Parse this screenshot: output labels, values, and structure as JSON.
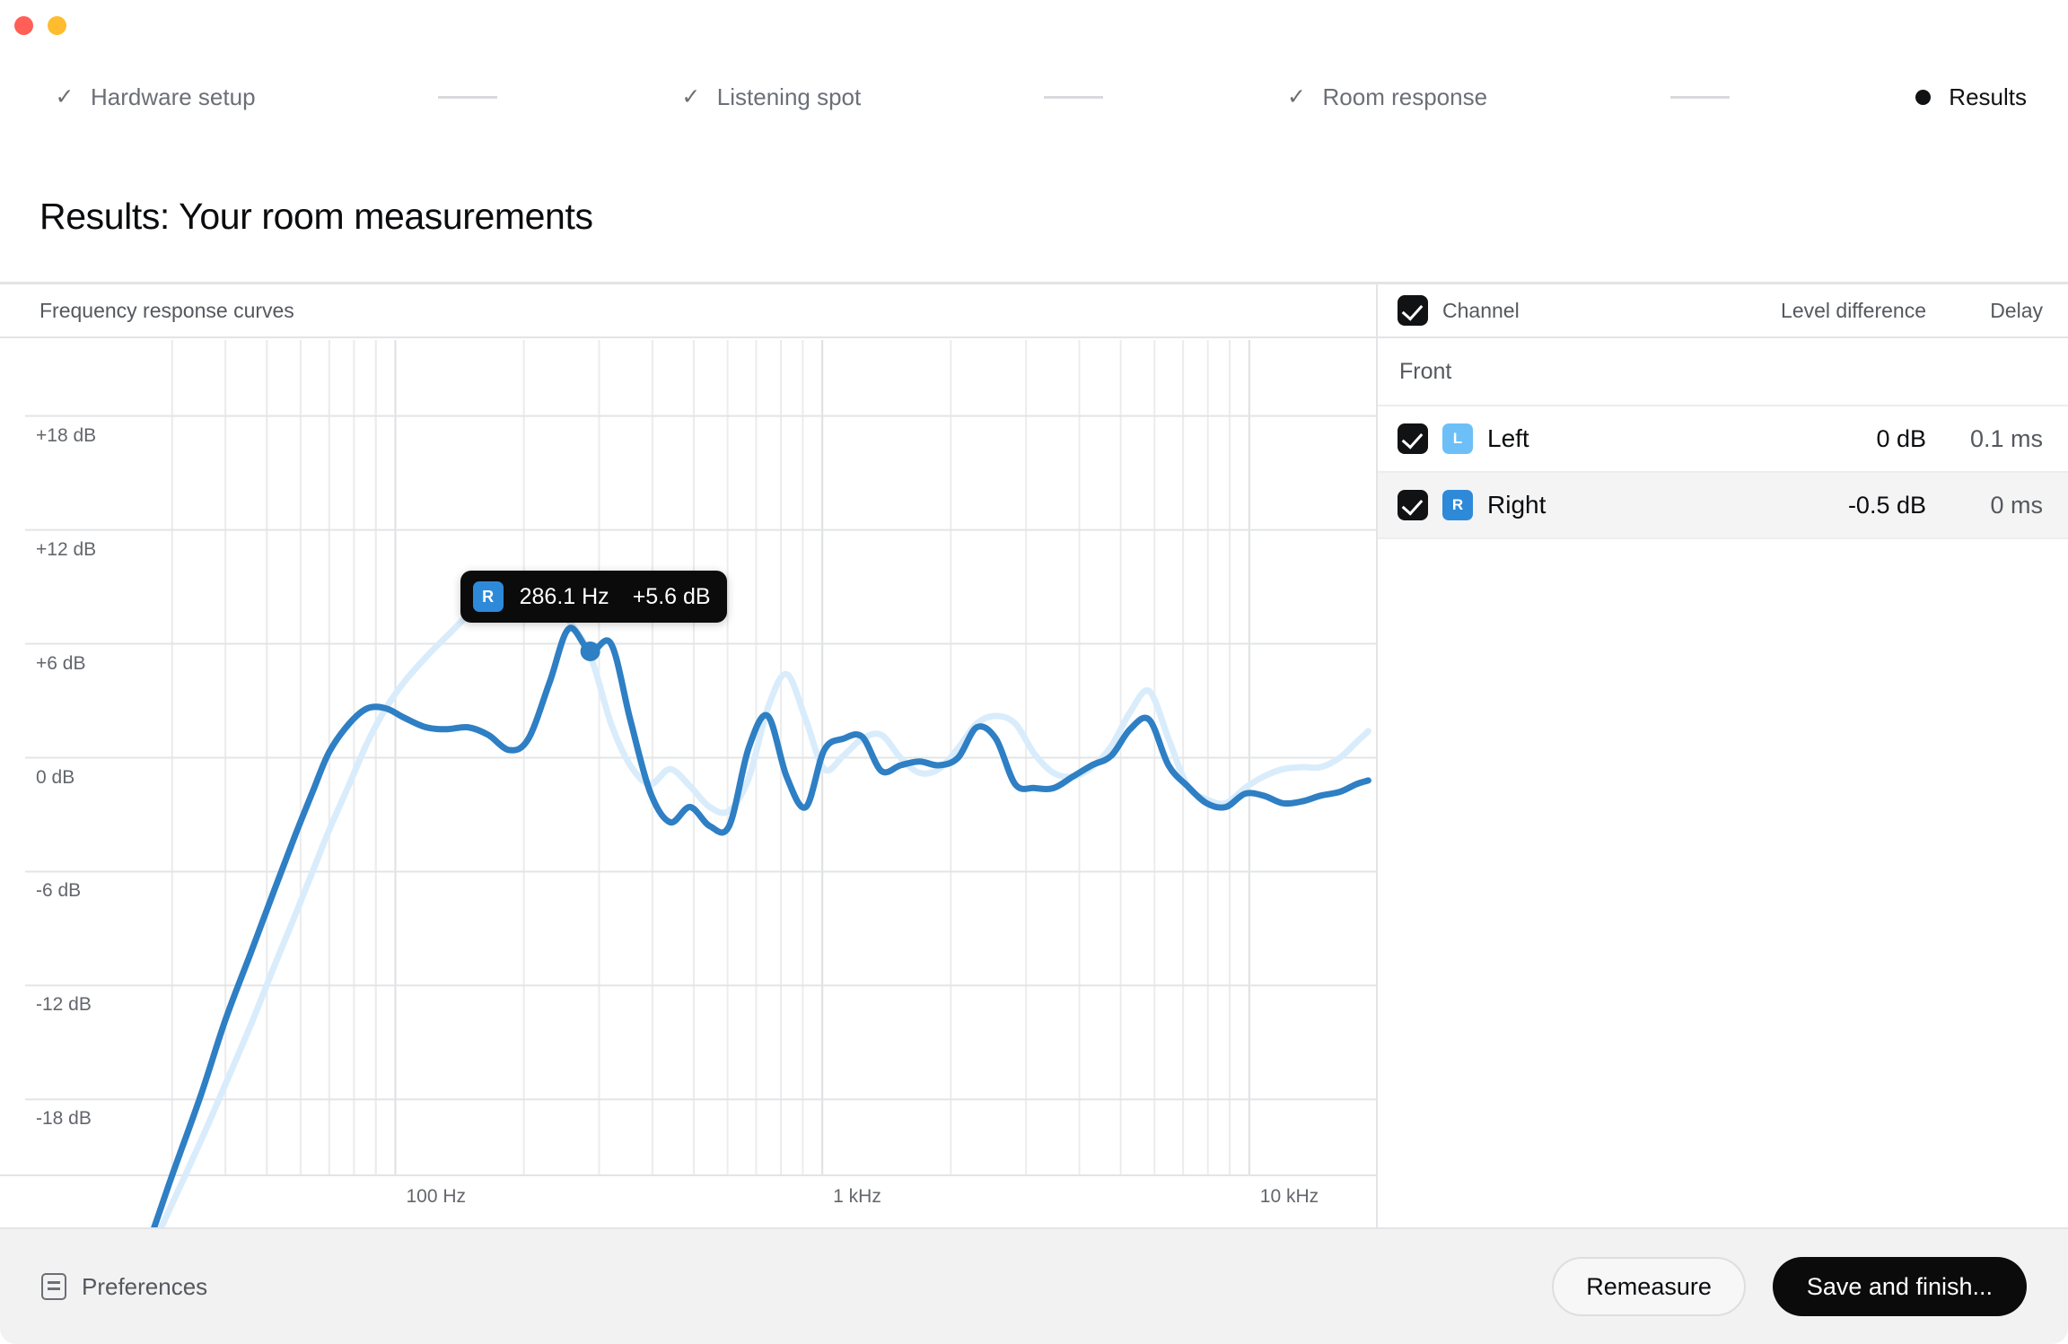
{
  "window": {
    "traffic_lights": [
      "close",
      "minimize"
    ]
  },
  "stepper": {
    "steps": [
      {
        "label": "Hardware setup",
        "mark": "check",
        "state": "done"
      },
      {
        "label": "Listening spot",
        "mark": "check",
        "state": "done"
      },
      {
        "label": "Room response",
        "mark": "check",
        "state": "done"
      },
      {
        "label": "Results",
        "mark": "bullet",
        "state": "current"
      }
    ]
  },
  "page": {
    "title": "Results: Your room measurements"
  },
  "chart_panel": {
    "header": "Frequency response curves"
  },
  "tooltip": {
    "badge": "R",
    "frequency": "286.1 Hz",
    "level": "+5.6 dB"
  },
  "table": {
    "header": {
      "select_all_checked": true,
      "channel": "Channel",
      "level_difference": "Level difference",
      "delay": "Delay"
    },
    "groups": [
      {
        "name": "Front",
        "rows": [
          {
            "checked": true,
            "badge": "L",
            "badge_color": "#6cc0f7",
            "name": "Left",
            "level": "0 dB",
            "delay": "0.1 ms",
            "selected": false
          },
          {
            "checked": true,
            "badge": "R",
            "badge_color": "#2e8ad9",
            "name": "Right",
            "level": "-0.5 dB",
            "delay": "0 ms",
            "selected": true
          }
        ]
      }
    ]
  },
  "footer": {
    "preferences": "Preferences",
    "remeasure": "Remeasure",
    "save_and_finish": "Save and finish..."
  },
  "colors": {
    "accent_right": "#2e7fc4",
    "accent_left": "#d9ecfb",
    "black": "#0b0b0c",
    "grid": "#e3e4e6",
    "text_muted": "#63666c"
  },
  "chart_data": {
    "type": "line",
    "title": "Frequency response curves",
    "xlabel": "Frequency",
    "ylabel": "Level",
    "xscale": "log",
    "xlim": [
      20,
      20000
    ],
    "ylim": [
      -22,
      22
    ],
    "xtick_labels": [
      "100 Hz",
      "1 kHz",
      "10 kHz"
    ],
    "xticks": [
      100,
      1000,
      10000
    ],
    "ytick_labels": [
      "+18 dB",
      "+12 dB",
      "+6 dB",
      "0 dB",
      "-6 dB",
      "-12 dB",
      "-18 dB"
    ],
    "yticks": [
      18,
      12,
      6,
      0,
      -6,
      -12,
      -18
    ],
    "grid": true,
    "legend_position": "none",
    "annotation": {
      "x": 286.1,
      "y": 5.6,
      "label": "286.1 Hz  +5.6 dB",
      "series": "Right"
    },
    "series": [
      {
        "name": "Left",
        "color": "#d9ecfb",
        "x": [
          22,
          26,
          30,
          35,
          40,
          46,
          52,
          58,
          64,
          70,
          78,
          86,
          95,
          105,
          118,
          132,
          148,
          165,
          185,
          205,
          230,
          255,
          286,
          320,
          355,
          395,
          440,
          490,
          545,
          605,
          672,
          745,
          825,
          915,
          1010,
          1120,
          1240,
          1375,
          1525,
          1690,
          1875,
          2080,
          2300,
          2550,
          2830,
          3140,
          3480,
          3860,
          4280,
          4750,
          5260,
          5830,
          6470,
          7170,
          7950,
          8810,
          9770,
          10800,
          12000,
          13300,
          14700,
          16300,
          17800,
          19000
        ],
        "y": [
          -29.5,
          -26.5,
          -23.5,
          -20.2,
          -17.2,
          -14.0,
          -11.0,
          -8.4,
          -6.0,
          -3.8,
          -1.4,
          0.8,
          2.6,
          4.0,
          5.3,
          6.4,
          7.5,
          8.3,
          8.8,
          8.9,
          8.4,
          7.2,
          5.4,
          1.8,
          -0.4,
          -1.4,
          -0.6,
          -1.5,
          -2.6,
          -2.8,
          -1.1,
          2.6,
          4.4,
          2.0,
          -0.6,
          0.1,
          1.0,
          1.2,
          0.0,
          -0.8,
          -0.6,
          0.5,
          1.8,
          2.2,
          1.8,
          0.2,
          -0.8,
          -1.0,
          -0.5,
          0.6,
          2.4,
          3.5,
          1.0,
          -1.5,
          -2.2,
          -2.4,
          -1.6,
          -1.0,
          -0.6,
          -0.5,
          -0.5,
          0.0,
          0.8,
          1.4
        ]
      },
      {
        "name": "Right",
        "color": "#2e7fc4",
        "x": [
          22,
          26,
          30,
          35,
          40,
          46,
          52,
          58,
          64,
          70,
          78,
          86,
          95,
          105,
          118,
          132,
          148,
          165,
          185,
          205,
          230,
          255,
          286,
          320,
          355,
          395,
          440,
          490,
          545,
          605,
          672,
          745,
          825,
          915,
          1010,
          1120,
          1240,
          1375,
          1525,
          1690,
          1875,
          2080,
          2300,
          2550,
          2830,
          3140,
          3480,
          3860,
          4280,
          4750,
          5260,
          5830,
          6470,
          7170,
          7950,
          8810,
          9770,
          10800,
          12000,
          13300,
          14700,
          16300,
          17800,
          19000
        ],
        "y": [
          -30.0,
          -26.0,
          -22.0,
          -17.8,
          -13.8,
          -10.2,
          -7.0,
          -4.2,
          -1.8,
          0.3,
          1.8,
          2.6,
          2.6,
          2.1,
          1.6,
          1.5,
          1.6,
          1.2,
          0.4,
          1.0,
          4.0,
          6.8,
          5.6,
          6.0,
          2.0,
          -1.8,
          -3.4,
          -2.6,
          -3.6,
          -3.6,
          0.5,
          2.2,
          -1.0,
          -2.6,
          0.4,
          1.0,
          1.1,
          -0.7,
          -0.4,
          -0.2,
          -0.4,
          0.0,
          1.6,
          1.0,
          -1.4,
          -1.6,
          -1.6,
          -1.0,
          -0.4,
          0.1,
          1.5,
          2.0,
          -0.4,
          -1.5,
          -2.4,
          -2.6,
          -1.9,
          -2.0,
          -2.4,
          -2.3,
          -2.0,
          -1.8,
          -1.4,
          -1.2
        ]
      }
    ]
  }
}
